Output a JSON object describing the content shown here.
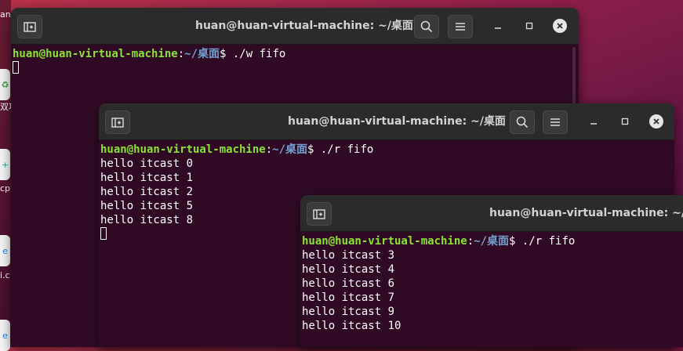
{
  "dock": {
    "labels": [
      "an",
      "双项",
      "cp",
      "i.c"
    ]
  },
  "windows": [
    {
      "id": "w-terminal",
      "title": "huan@huan-virtual-machine: ~/桌面",
      "prompt_user": "huan@huan-virtual-machine",
      "prompt_colon": ":",
      "prompt_path": "~/桌面",
      "prompt_dollar": "$",
      "command": " ./w fifo",
      "output": []
    },
    {
      "id": "r-terminal-1",
      "title": "huan@huan-virtual-machine: ~/桌面",
      "prompt_user": "huan@huan-virtual-machine",
      "prompt_colon": ":",
      "prompt_path": "~/桌面",
      "prompt_dollar": "$",
      "command": " ./r fifo",
      "output": [
        "hello itcast 0",
        "hello itcast 1",
        "hello itcast 2",
        "hello itcast 5",
        "hello itcast 8"
      ]
    },
    {
      "id": "r-terminal-2",
      "title": "huan@huan-virtual-machine: ~/桌",
      "prompt_user": "huan@huan-virtual-machine",
      "prompt_colon": ":",
      "prompt_path": "~/桌面",
      "prompt_dollar": "$",
      "command": " ./r fifo",
      "output": [
        "hello itcast 3",
        "hello itcast 4",
        "hello itcast 6",
        "hello itcast 7",
        "hello itcast 9",
        "hello itcast 10"
      ]
    }
  ],
  "colors": {
    "terminal_bg": "#300a24",
    "titlebar_bg": "#2b2b2b",
    "prompt_user": "#8ae234",
    "prompt_path": "#729fcf"
  },
  "icons": [
    "new-tab-icon",
    "search-icon",
    "hamburger-menu-icon",
    "minimize-icon",
    "maximize-icon",
    "close-icon"
  ]
}
